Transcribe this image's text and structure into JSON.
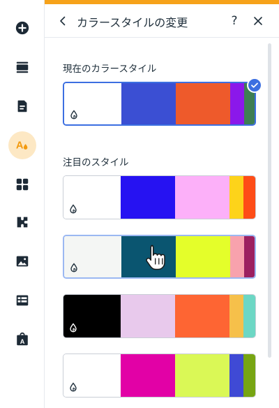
{
  "header": {
    "title": "カラースタイルの変更",
    "help_label": "?"
  },
  "sections": {
    "current_title": "現在のカラースタイル",
    "featured_title": "注目のスタイル"
  },
  "rail": {
    "items": [
      "add-icon",
      "sections-icon",
      "pages-icon",
      "theme-icon",
      "apps-icon",
      "plugins-icon",
      "media-icon",
      "table-icon",
      "business-icon"
    ],
    "active_index": 3
  },
  "palettes": {
    "current": {
      "colors": [
        "#ffffff",
        "#3b4fd3",
        "#ee5a2b",
        "#8b18ea",
        "#3e7e53"
      ],
      "selected": true
    },
    "featured": [
      {
        "colors": [
          "#ffffff",
          "#2612f2",
          "#fcb0f9",
          "#fdd31a",
          "#fe4d17"
        ]
      },
      {
        "colors": [
          "#f4f6f4",
          "#0a5570",
          "#e4fe2a",
          "#f8a2ad",
          "#9c2060"
        ],
        "hovered": true
      },
      {
        "colors": [
          "#000000",
          "#e8c9ec",
          "#fe6533",
          "#f6c04a",
          "#6cd7c4"
        ]
      },
      {
        "colors": [
          "#ffffff",
          "#e201a6",
          "#daf856",
          "#3f4ad5",
          "#77a512"
        ]
      }
    ]
  },
  "colors": {
    "accent": "#3c6fe1",
    "brand_orange": "#f6a21a"
  }
}
